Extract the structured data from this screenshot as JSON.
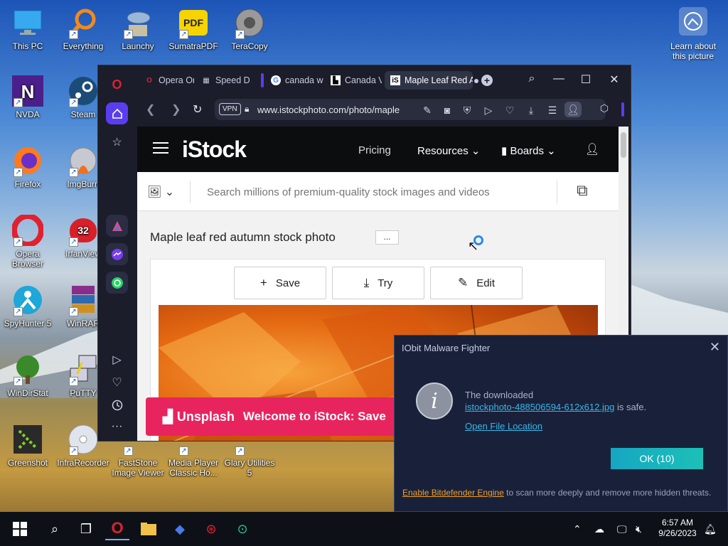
{
  "desktop": {
    "icons": [
      {
        "label": "This PC",
        "name": "this-pc"
      },
      {
        "label": "Everything",
        "name": "everything"
      },
      {
        "label": "Launchy",
        "name": "launchy"
      },
      {
        "label": "SumatraPDF",
        "name": "sumatrapdf"
      },
      {
        "label": "TeraCopy",
        "name": "teracopy"
      },
      {
        "label": "NVDA",
        "name": "nvda"
      },
      {
        "label": "Steam",
        "name": "steam"
      },
      {
        "label": "Firefox",
        "name": "firefox"
      },
      {
        "label": "ImgBurn",
        "name": "imgburn"
      },
      {
        "label": "Opera Browser",
        "name": "opera-browser"
      },
      {
        "label": "IrfanView",
        "name": "irfanview"
      },
      {
        "label": "SpyHunter 5",
        "name": "spyhunter"
      },
      {
        "label": "WinRAR",
        "name": "winrar"
      },
      {
        "label": "WinDirStat",
        "name": "windirstat"
      },
      {
        "label": "PuTTY",
        "name": "putty"
      },
      {
        "label": "Greenshot",
        "name": "greenshot"
      },
      {
        "label": "InfraRecorder",
        "name": "infrarecorder"
      },
      {
        "label": "FastStone Image Viewer",
        "name": "faststone"
      },
      {
        "label": "Media Player Classic Ho...",
        "name": "mpc"
      },
      {
        "label": "Glary Utilities 5",
        "name": "glary"
      }
    ],
    "learn_about": "Learn about this picture",
    "pdf_badge": "PDF",
    "irfan_badge": "32"
  },
  "browser": {
    "tabs": [
      {
        "label": "Opera Or"
      },
      {
        "label": "Speed Di"
      },
      {
        "label": "canada w"
      },
      {
        "label": "Canada V"
      },
      {
        "label": "Maple Leaf Red A"
      }
    ],
    "active_favicon": "iS",
    "url": "www.istockphoto.com/photo/maple",
    "vpn_label": "VPN",
    "new_tab": "+"
  },
  "istock": {
    "logo": "iStock",
    "nav": {
      "pricing": "Pricing",
      "resources": "Resources",
      "boards": "Boards"
    },
    "search_placeholder": "Search millions of premium-quality stock images and videos",
    "photo_title": "Maple leaf red autumn stock photo",
    "more_btn": "...",
    "actions": {
      "save": "Save",
      "try": "Try",
      "edit": "Edit"
    },
    "banner_logo": "Unsplash",
    "banner_text": "Welcome to iStock: Save"
  },
  "popup": {
    "title": "IObit Malware Fighter",
    "line1": "The downloaded",
    "file_link": "istockphoto-488506594-612x612.jpg",
    "line2_suffix": " is safe.",
    "open_location": "Open File Location",
    "ok_label": "OK (10)",
    "footer_link": "Enable Bitdefender Engine",
    "footer_text": " to scan more deeply and remove more hidden threats."
  },
  "taskbar": {
    "time": "6:57 AM",
    "date": "9/26/2023"
  },
  "colors": {
    "opera_red": "#e0212f",
    "istock_black": "#0c0d0f",
    "banner_pink": "#e8245f",
    "popup_bg": "#19213a",
    "ok_teal": "#16a6c2",
    "link_blue": "#3ab6e8"
  }
}
